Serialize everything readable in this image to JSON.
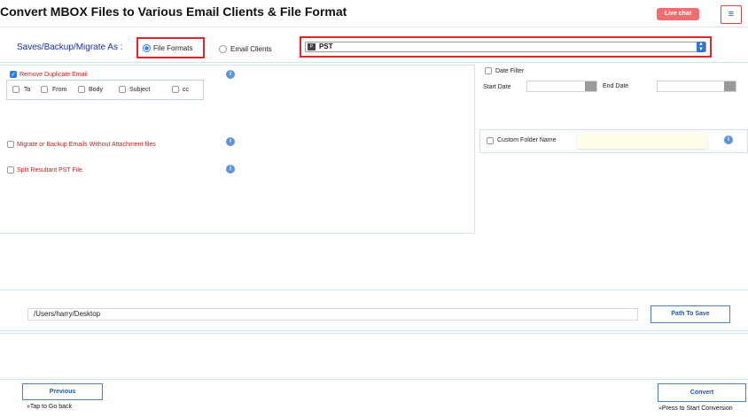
{
  "header": {
    "title": "Convert MBOX Files to Various Email Clients & File Format",
    "live_chat": "Live chat",
    "menu_glyph": "≡"
  },
  "saves": {
    "label": "Saves/Backup/Migrate As :",
    "options": [
      {
        "label": "File Formats",
        "selected": true
      },
      {
        "label": "Email Clients",
        "selected": false
      }
    ],
    "format_select": {
      "value": "PST",
      "icon": "pst-file-icon",
      "icon_text": "P"
    }
  },
  "options": {
    "remove_duplicate": {
      "label": "Remove Duplicate Email",
      "checked": true
    },
    "duplicate_fields": [
      {
        "label": "To",
        "checked": false
      },
      {
        "label": "From",
        "checked": false
      },
      {
        "label": "Body",
        "checked": false
      },
      {
        "label": "Subject",
        "checked": false
      },
      {
        "label": "cc",
        "checked": false
      }
    ],
    "without_attachment": {
      "label": "Migrate or Backup Emails Without Attachment files",
      "checked": false
    },
    "split_pst": {
      "label": "Split Resultant PST File.",
      "checked": false
    },
    "info_glyph": "i"
  },
  "filters": {
    "date_filter": {
      "label": "Date Filter",
      "checked": false
    },
    "start_date_label": "Start Date",
    "end_date_label": "End Date",
    "start_date_value": "",
    "end_date_value": "",
    "custom_folder": {
      "label": "Custom Folder Name",
      "checked": false,
      "value": ""
    }
  },
  "destination": {
    "path": "/Users/harry/Desktop",
    "button": "Path To Save"
  },
  "footer": {
    "previous": "Previous",
    "previous_hint": "»Tap to Go back",
    "convert": "Convert",
    "convert_hint": "»Press to Start Conversion"
  },
  "colors": {
    "highlight_red": "#e0262b",
    "accent_blue": "#2b7be2",
    "label_red": "#c51b1b",
    "live_chat_bg": "#f06d72"
  }
}
